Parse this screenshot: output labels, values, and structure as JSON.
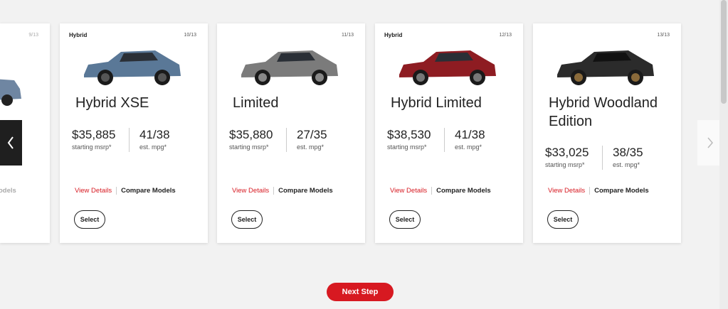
{
  "colors": {
    "accent": "#d71921",
    "card_bg": "#ffffff",
    "page_bg": "#f2f2f2"
  },
  "partial_card": {
    "count": "9/13",
    "models_label": "odels"
  },
  "cards": [
    {
      "tag": "Hybrid",
      "count": "10/13",
      "name": "Hybrid XSE",
      "price": "$35,885",
      "price_label": "starting msrp*",
      "mpg": "41/38",
      "mpg_label": "est. mpg*",
      "view_details": "View Details",
      "compare": "Compare Models",
      "select": "Select",
      "car_color": "#5a7897"
    },
    {
      "tag": "",
      "count": "11/13",
      "name": "Limited",
      "price": "$35,880",
      "price_label": "starting msrp*",
      "mpg": "27/35",
      "mpg_label": "est. mpg*",
      "view_details": "View Details",
      "compare": "Compare Models",
      "select": "Select",
      "car_color": "#7b7b7b"
    },
    {
      "tag": "Hybrid",
      "count": "12/13",
      "name": "Hybrid Limited",
      "price": "$38,530",
      "price_label": "starting msrp*",
      "mpg": "41/38",
      "mpg_label": "est. mpg*",
      "view_details": "View Details",
      "compare": "Compare Models",
      "select": "Select",
      "car_color": "#8e1c22"
    },
    {
      "tag": "",
      "count": "13/13",
      "name": "Hybrid Woodland Edition",
      "price": "$33,025",
      "price_label": "starting msrp*",
      "mpg": "38/35",
      "mpg_label": "est. mpg*",
      "view_details": "View Details",
      "compare": "Compare Models",
      "select": "Select",
      "car_color": "#2b2b2b"
    }
  ],
  "carousel": {
    "prev_icon": "chevron-left-icon",
    "next_icon": "chevron-right-icon"
  },
  "footer": {
    "next_step": "Next Step"
  }
}
